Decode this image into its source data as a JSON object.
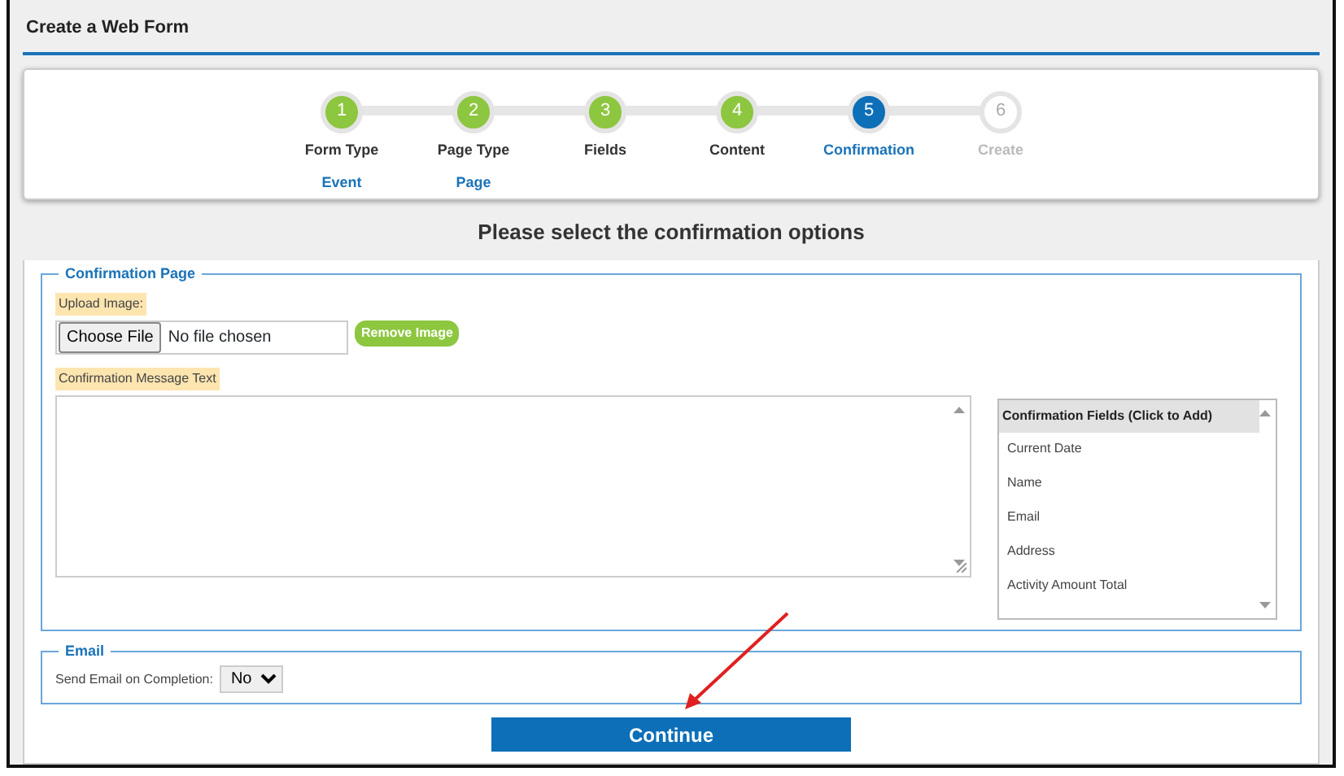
{
  "window": {
    "title": "Create a Web Form"
  },
  "steps": [
    {
      "number": "1",
      "label": "Form Type",
      "value": "Event",
      "completed": true,
      "selected": false
    },
    {
      "number": "2",
      "label": "Page Type",
      "value": "Page",
      "completed": true,
      "selected": false
    },
    {
      "number": "3",
      "label": "Fields",
      "completed": true,
      "selected": false
    },
    {
      "number": "4",
      "label": "Content",
      "completed": true,
      "selected": false
    },
    {
      "number": "5",
      "label": "Confirmation",
      "selected": true
    },
    {
      "number": "6",
      "label": "Create",
      "completed": false,
      "selected": false
    }
  ],
  "heading": "Please select the confirmation options",
  "confirmation_page": {
    "legend": "Confirmation Page",
    "upload_label": "Upload Image:",
    "file_button": "Choose File",
    "file_status": "No file chosen",
    "remove_button": "Remove Image",
    "message_label": "Confirmation Message Text",
    "fields_list": {
      "header": "Confirmation Fields (Click to Add)",
      "items": [
        "Current Date",
        "Name",
        "Email",
        "Address",
        "Activity Amount Total"
      ]
    }
  },
  "email": {
    "legend": "Email",
    "label": "Send Email on Completion:",
    "value": "No"
  },
  "continue_button": "Continue"
}
